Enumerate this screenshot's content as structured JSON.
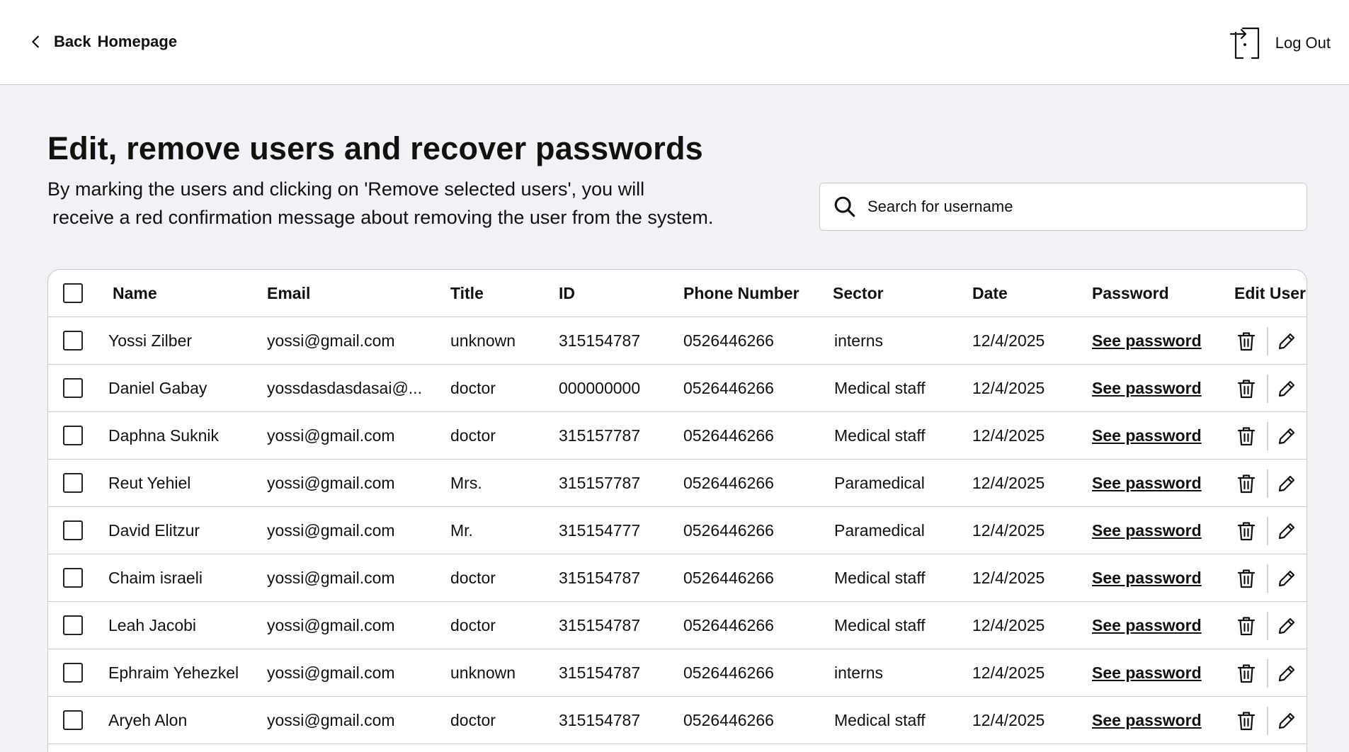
{
  "header": {
    "back_label": "Back",
    "homepage_label": "Homepage",
    "logout_label": "Log Out"
  },
  "page": {
    "title": "Edit, remove users and recover passwords",
    "description_line1": "By marking the users and clicking on 'Remove selected users', you will",
    "description_line2": "receive a red confirmation message about removing the user from the system."
  },
  "search": {
    "placeholder": "Search for username",
    "value": ""
  },
  "table": {
    "columns": [
      "Name",
      "Email",
      "Title",
      "ID",
      "Phone Number",
      "Sector",
      "Date",
      "Password",
      "Edit User"
    ],
    "password_link_label": "See password",
    "rows": [
      {
        "name": "Yossi Zilber",
        "email": "yossi@gmail.com",
        "title": "unknown",
        "id": "315154787",
        "phone": "0526446266",
        "sector": "interns",
        "date": "12/4/2025"
      },
      {
        "name": "Daniel Gabay",
        "email": "yossdasdasdasai@...",
        "title": "doctor",
        "id": "000000000",
        "phone": "0526446266",
        "sector": "Medical staff",
        "date": "12/4/2025"
      },
      {
        "name": "Daphna Suknik",
        "email": "yossi@gmail.com",
        "title": "doctor",
        "id": "315157787",
        "phone": "0526446266",
        "sector": "Medical staff",
        "date": "12/4/2025"
      },
      {
        "name": "Reut Yehiel",
        "email": "yossi@gmail.com",
        "title": "Mrs.",
        "id": "315157787",
        "phone": "0526446266",
        "sector": "Paramedical",
        "date": "12/4/2025"
      },
      {
        "name": "David Elitzur",
        "email": "yossi@gmail.com",
        "title": "Mr.",
        "id": "315154777",
        "phone": "0526446266",
        "sector": "Paramedical",
        "date": "12/4/2025"
      },
      {
        "name": "Chaim israeli",
        "email": "yossi@gmail.com",
        "title": "doctor",
        "id": "315154787",
        "phone": "0526446266",
        "sector": "Medical staff",
        "date": "12/4/2025"
      },
      {
        "name": "Leah Jacobi",
        "email": "yossi@gmail.com",
        "title": "doctor",
        "id": "315154787",
        "phone": "0526446266",
        "sector": "Medical staff",
        "date": "12/4/2025"
      },
      {
        "name": "Ephraim Yehezkel",
        "email": "yossi@gmail.com",
        "title": "unknown",
        "id": "315154787",
        "phone": "0526446266",
        "sector": "interns",
        "date": "12/4/2025"
      },
      {
        "name": "Aryeh Alon",
        "email": "yossi@gmail.com",
        "title": "doctor",
        "id": "315154787",
        "phone": "0526446266",
        "sector": "Medical staff",
        "date": "12/4/2025"
      }
    ]
  }
}
